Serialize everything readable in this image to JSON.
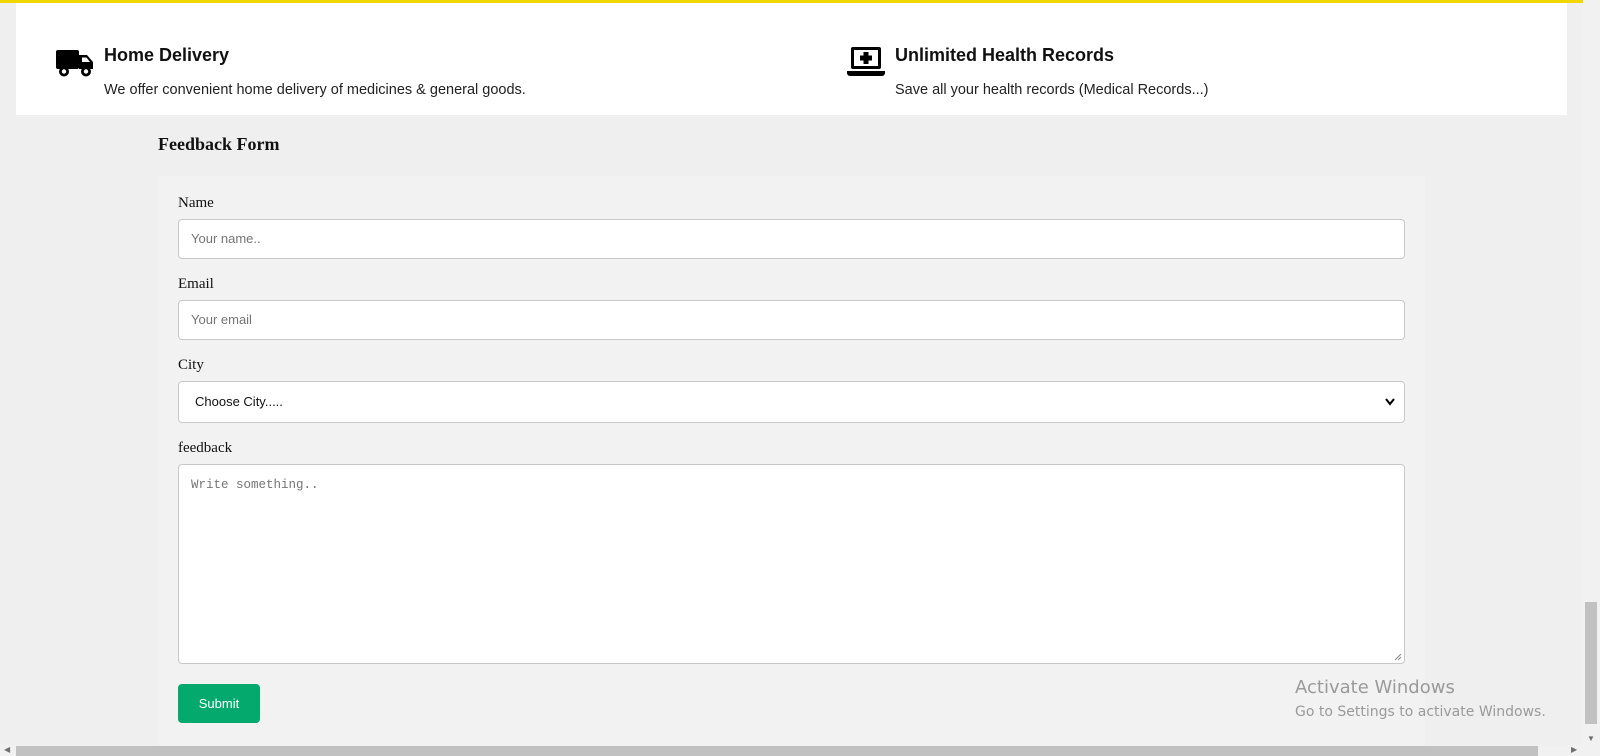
{
  "features": [
    {
      "icon": "truck-icon",
      "title": "Home Delivery",
      "description": "We offer convenient home delivery of medicines & general goods."
    },
    {
      "icon": "laptop-medical-icon",
      "title": "Unlimited Health Records",
      "description": "Save all your health records (Medical Records...)"
    }
  ],
  "form": {
    "title": "Feedback Form",
    "name_label": "Name",
    "name_placeholder": "Your name..",
    "email_label": "Email",
    "email_placeholder": "Your email",
    "city_label": "City",
    "city_selected": "Choose City.....",
    "feedback_label": "feedback",
    "feedback_placeholder": "Write something..",
    "submit_label": "Submit"
  },
  "watermark": {
    "line1": "Activate Windows",
    "line2": "Go to Settings to activate Windows."
  },
  "colors": {
    "accent_top_bar": "#f2d600",
    "submit_button": "#04aa6d"
  }
}
